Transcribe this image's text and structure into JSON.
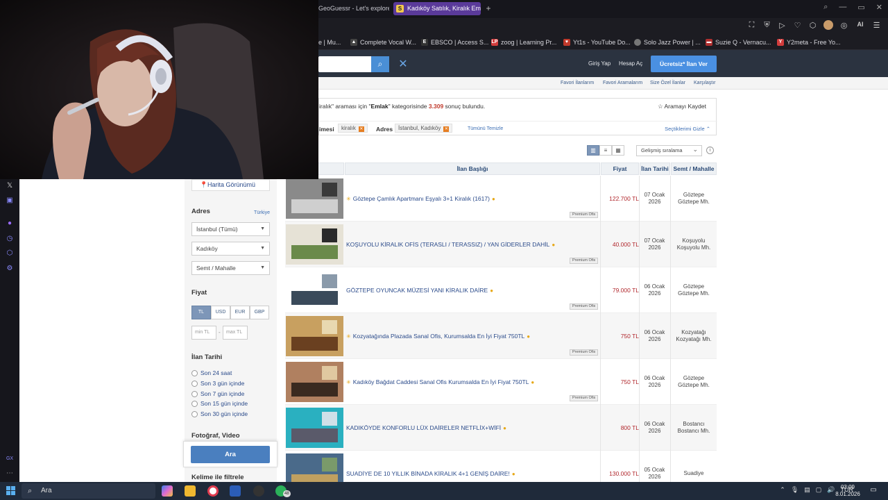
{
  "browser": {
    "tabs": [
      {
        "label": "GeoGuessr - Let's explore",
        "active": false
      },
      {
        "label": "Kadıköy Satılık, Kiralık Emlak",
        "active": true,
        "favicon_letter": "S"
      }
    ],
    "bookmarks": [
      {
        "label": "e | Mu..."
      },
      {
        "label": "Complete Vocal W..."
      },
      {
        "label": "EBSCO | Access S...",
        "icon_letter": "E"
      },
      {
        "label": "zoog | Learning Pr...",
        "icon_letter": "LP"
      },
      {
        "label": "Yt1s - YouTube Do..."
      },
      {
        "label": "Solo Jazz Power | ..."
      },
      {
        "label": "Suzie Q - Vernacu..."
      },
      {
        "label": "Y2meta - Free Yo..."
      }
    ],
    "ai_label": "AI"
  },
  "site": {
    "header_links": {
      "login": "Giriş Yap",
      "register": "Hesap Aç",
      "post_ad": "Ücretsiz* İlan Ver"
    },
    "subnav": [
      "Favori İlanlarım",
      "Favori Aramalarım",
      "Size Özel İlanlar",
      "Karşılaştır"
    ],
    "result": {
      "query_tail": "iralık",
      "mid_text": "\" araması için \"",
      "category": "Emlak",
      "cat_suffix": "\" kategorisinde",
      "count": "3.309",
      "count_suffix": " sonuç bulundu.",
      "save_search": "Aramayı Kaydet"
    },
    "filters_applied": {
      "kw_label": "imesi",
      "kw_value": "kiralık",
      "addr_label": "Adres",
      "addr_value": "İstanbul, Kadıköy",
      "clear_all": "Tümünü Temizle",
      "hide": "Seçtiklerimi Gizle"
    },
    "sort": "Gelişmiş sıralama",
    "columns": {
      "title": "İlan Başlığı",
      "price": "Fiyat",
      "date": "İlan Tarihi",
      "location": "Semt / Mahalle"
    },
    "premium_label": "Premium Ofis",
    "listings": [
      {
        "title": "Göztepe Çamlık Apartmanı Eşyalı 3+1 Kiralık (1617)",
        "price": "122.700 TL",
        "date1": "07 Ocak",
        "date2": "2026",
        "loc1": "Göztepe",
        "loc2": "Göztepe Mh.",
        "star": true,
        "premium": true
      },
      {
        "title": "KOŞUYOLU KİRALIK OFİS (TERASLI / TERASSIZ) / YAN GİDERLER DAHİL",
        "price": "40.000 TL",
        "date1": "07 Ocak",
        "date2": "2026",
        "loc1": "Koşuyolu",
        "loc2": "Koşuyolu Mh.",
        "star": false,
        "premium": true
      },
      {
        "title": "GÖZTEPE OYUNCAK MÜZESİ YANI KİRALIK DAİRE",
        "price": "79.000 TL",
        "date1": "06 Ocak",
        "date2": "2026",
        "loc1": "Göztepe",
        "loc2": "Göztepe Mh.",
        "star": false,
        "premium": true
      },
      {
        "title": "Kozyatağında Plazada Sanal Ofis, Kurumsalda En İyi Fiyat 750TL",
        "price": "750 TL",
        "date1": "06 Ocak",
        "date2": "2026",
        "loc1": "Kozyatağı",
        "loc2": "Kozyatağı Mh.",
        "star": true,
        "premium": true
      },
      {
        "title": "Kadıköy Bağdat Caddesi Sanal Ofis Kurumsalda En İyi Fiyat 750TL",
        "price": "750 TL",
        "date1": "06 Ocak",
        "date2": "2026",
        "loc1": "Göztepe",
        "loc2": "Göztepe Mh.",
        "star": true,
        "premium": true
      },
      {
        "title": "KADIKÖYDE KONFORLU LÜX DAİRELER NETFLİX+WİFİ",
        "price": "800 TL",
        "date1": "06 Ocak",
        "date2": "2026",
        "loc1": "Bostancı",
        "loc2": "Bostancı Mh.",
        "star": false,
        "premium": false
      },
      {
        "title": "SUADİYE DE 10 YILLIK BİNADA KİRALIK 4+1 GENİŞ DAİRE!",
        "price": "130.000 TL",
        "date1": "05 Ocak",
        "date2": "2026",
        "loc1": "Suadiye",
        "loc2": "",
        "star": false,
        "premium": false
      }
    ],
    "filter_panel": {
      "map_view": "Harita Görünümü",
      "address_heading": "Adres",
      "country_link": "Türkiye",
      "city": "İstanbul (Tümü)",
      "district": "Kadıköy",
      "neighborhood": "Semt / Mahalle",
      "price_heading": "Fiyat",
      "currencies": [
        "TL",
        "USD",
        "EUR",
        "GBP"
      ],
      "min_placeholder": "min TL",
      "max_placeholder": "max TL",
      "date_heading": "İlan Tarihi",
      "date_options": [
        "Son 24 saat",
        "Son 3 gün içinde",
        "Son 7 gün içinde",
        "Son 15 gün içinde",
        "Son 30 gün içinde"
      ],
      "photo_heading": "Fotoğraf, Video",
      "search_button": "Ara",
      "keyword_heading": "Kelime ile filtrele"
    }
  },
  "taskbar": {
    "search": "Ara",
    "badge": "48",
    "lang": "TUR",
    "time": "03:09",
    "date": "8.01.2026"
  }
}
